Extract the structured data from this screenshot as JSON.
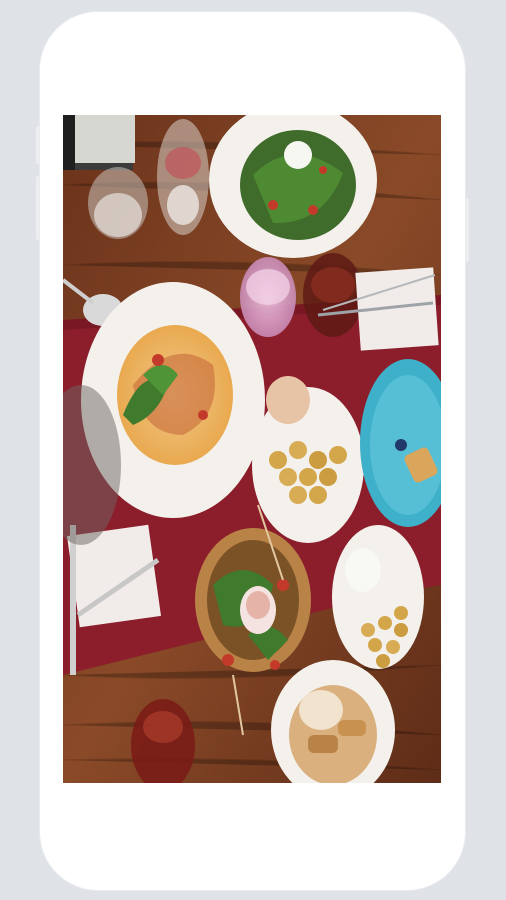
{
  "device": {
    "frame_color": "#ffffff",
    "background_color": "#dfe2e6"
  },
  "photo": {
    "subject": "overhead-food-table",
    "colors": {
      "wood": "#7a3f22",
      "tablecloth": "#8c1e2c",
      "plate": "#f4f1ec",
      "teal_plate": "#3fb0c9",
      "greens": "#3f6b2b",
      "potato": "#d3a64a"
    }
  }
}
